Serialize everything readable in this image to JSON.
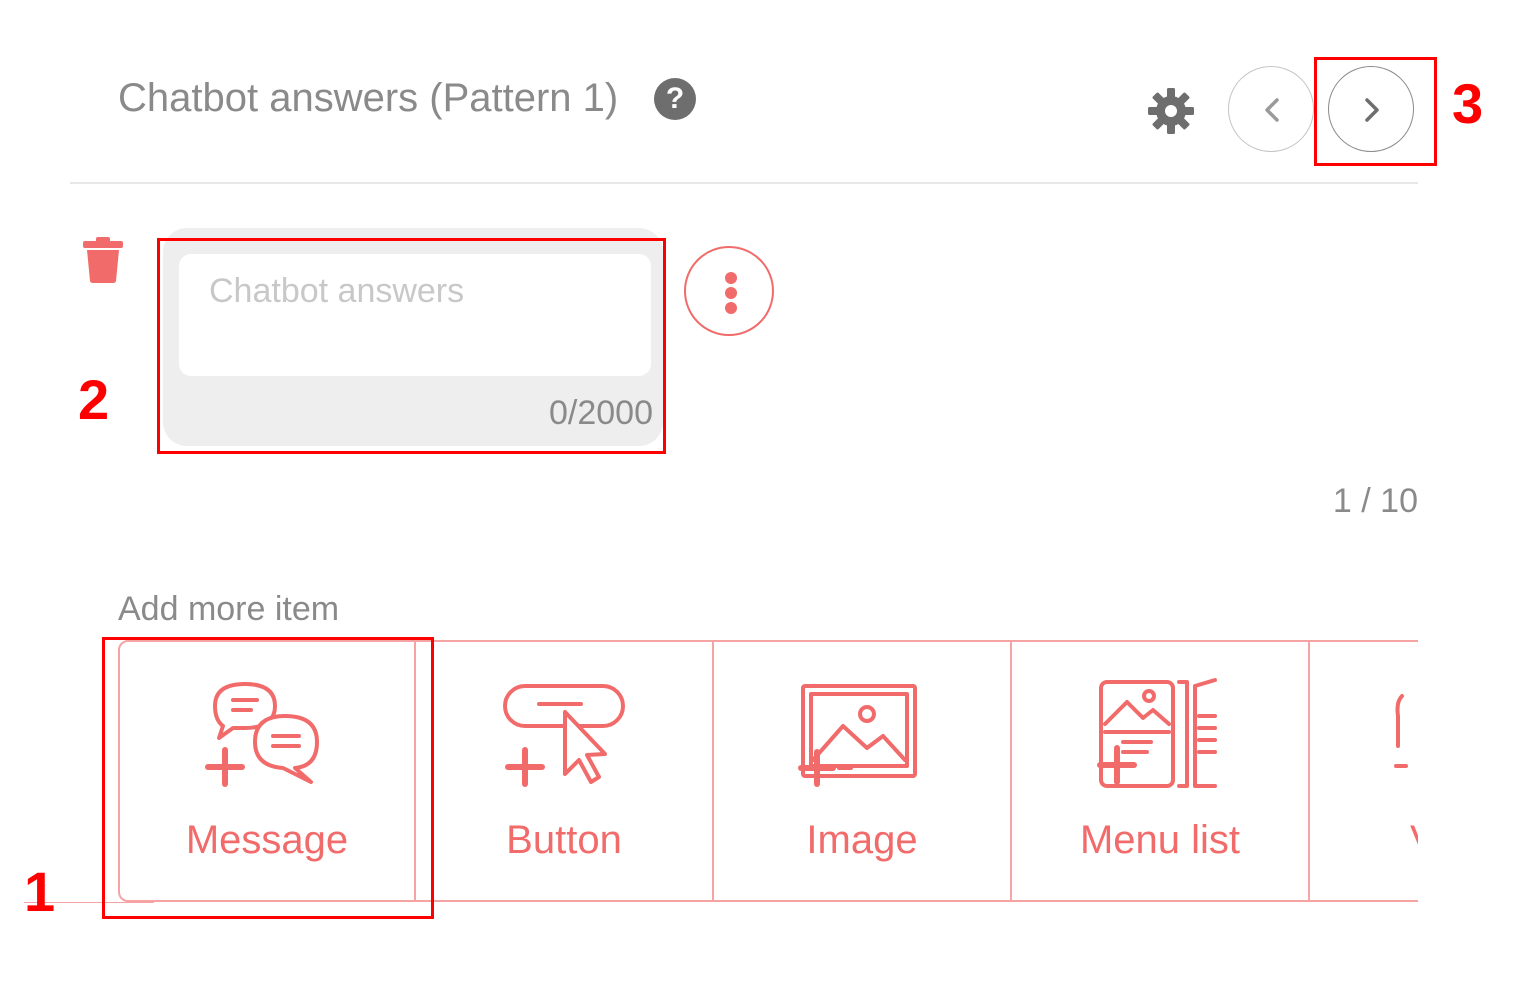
{
  "header": {
    "title": "Chatbot answers (Pattern 1)",
    "help_glyph": "?",
    "icons": {
      "help": "question-circle-icon",
      "settings": "gear-icon",
      "prev": "chevron-left-icon",
      "next": "chevron-right-icon"
    }
  },
  "editor": {
    "placeholder": "Chatbot answers",
    "value": "",
    "char_count": "0/2000",
    "icons": {
      "delete": "trash-icon",
      "more": "more-vertical-icon"
    }
  },
  "pagination": {
    "counter": "1 / 10"
  },
  "add_more": {
    "label": "Add more item",
    "items": [
      {
        "label": "Message",
        "icon": "message-add-icon"
      },
      {
        "label": "Button",
        "icon": "button-add-icon"
      },
      {
        "label": "Image",
        "icon": "image-add-icon"
      },
      {
        "label": "Menu list",
        "icon": "menu-list-add-icon"
      },
      {
        "label": "V",
        "icon": "partial-item-icon"
      }
    ]
  },
  "annotations": {
    "one": "1",
    "two": "2",
    "three": "3"
  },
  "colors": {
    "accent": "#f26b6b",
    "accent_light": "#f5a3a3",
    "trash": "#f26b6b",
    "annotation": "#ff0000",
    "text_muted": "#8a8a8a"
  }
}
